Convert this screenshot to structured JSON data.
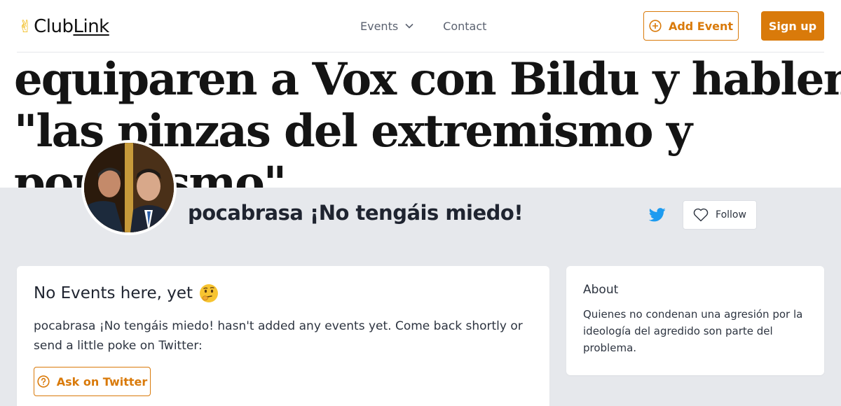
{
  "header": {
    "logo_club": "Club",
    "logo_link": "Link",
    "nav": {
      "events_label": "Events",
      "contact_label": "Contact"
    },
    "add_event_label": "Add Event",
    "signup_label": "Sign up"
  },
  "banner": {
    "text": "equiparen a Vox con Bildu y hablen de\n\"las pinzas del extremismo y\npopulismo\""
  },
  "profile": {
    "name": "pocabrasa ¡No tengáis miedo!",
    "follow_label": "Follow"
  },
  "events": {
    "title": "No Events here, yet",
    "description": "pocabrasa ¡No tengáis miedo! hasn't added any events yet. Come back shortly or send a little poke on Twitter:",
    "ask_label": "Ask on Twitter"
  },
  "about": {
    "title": "About",
    "text": "Quienes no condenan una agresión por la ideología del agredido son parte del problema."
  },
  "colors": {
    "accent": "#d97a0a",
    "twitter": "#1d9bf0",
    "page_bg": "#e6e8ec"
  },
  "icons": [
    "victory-hand-icon",
    "chevron-down-icon",
    "plus-circle-icon",
    "twitter-icon",
    "heart-icon",
    "question-circle-icon",
    "thinking-face-icon"
  ]
}
